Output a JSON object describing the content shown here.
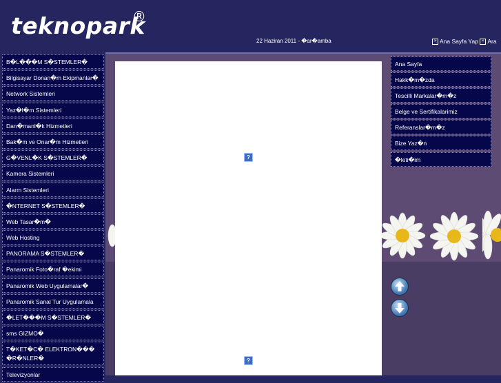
{
  "header": {
    "logo": "teknopark",
    "registered": "®",
    "date": "22 Haziran 2011 - �ar�amba",
    "links": [
      {
        "label": "Ana Sayfa Yap"
      },
      {
        "label": "Ara"
      }
    ]
  },
  "left_nav": [
    "B�L���M S�STEMLER�",
    "Bilgisayar Donan�m Ekipmanlar�",
    "Network Sistemleri",
    "Yaz�l�m Sistemleri",
    "Dan�manl�k Hizmetleri",
    "Bak�m ve Onar�m Hizmetleri",
    "G�VENL�K S�STEMLER�",
    "Kamera Sistemleri",
    "Alarm Sistemleri",
    "�NTERNET S�STEMLER�",
    "Web Tasar�m�",
    "Web Hosting",
    "PANORAMA S�STEMLER�",
    "Panaromik Foto�raf �ekimi",
    "Panaromik Web Uygulamalar�",
    "Panaromik Sanal Tur Uygulamala",
    "�LET���M S�STEMLER�",
    "sms GIZMO�",
    "T�KET�C� ELEKTRON��� �R�NLER�",
    "Televizyonlar"
  ],
  "right_nav": [
    "Ana Sayfa",
    "Hakk�m�zda",
    "Tescilli Markalar�m�z",
    "Belge ve Sertifikalarimiz",
    "Referanslar�m�z",
    "Bize Yaz�n",
    "�leti�im"
  ],
  "placeholder_icon": "?"
}
